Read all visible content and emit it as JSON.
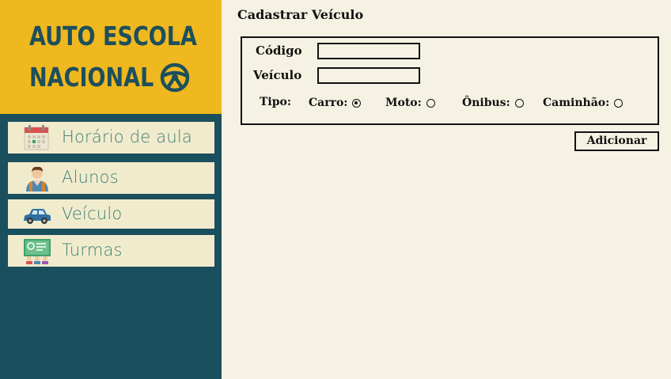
{
  "sidebar": {
    "logo": {
      "line1": "AUTO ESCOLA",
      "line2": "NACIONAL",
      "icon": "steering-wheel-icon"
    },
    "items": [
      {
        "label": "Horário de aula",
        "icon": "calendar-icon"
      },
      {
        "label": "Alunos",
        "icon": "student-icon"
      },
      {
        "label": "Veículo",
        "icon": "car-icon"
      },
      {
        "label": "Turmas",
        "icon": "classroom-icon"
      }
    ]
  },
  "main": {
    "title": "Cadastrar Veículo",
    "form": {
      "codigo_label": "Código",
      "codigo_value": "",
      "veiculo_label": "Veículo",
      "veiculo_value": "",
      "tipo_label": "Tipo:",
      "options": [
        {
          "label": "Carro:",
          "checked": true
        },
        {
          "label": "Moto:",
          "checked": false
        },
        {
          "label": "Ônibus:",
          "checked": false
        },
        {
          "label": "Caminhão:",
          "checked": false
        }
      ]
    },
    "add_button": "Adicionar"
  },
  "colors": {
    "sidebar_bg": "#1a4f5e",
    "logo_bg": "#efb81f",
    "nav_item_bg": "#f1ebcd",
    "nav_text": "#3f7f74",
    "main_bg": "#f5f2e3"
  }
}
